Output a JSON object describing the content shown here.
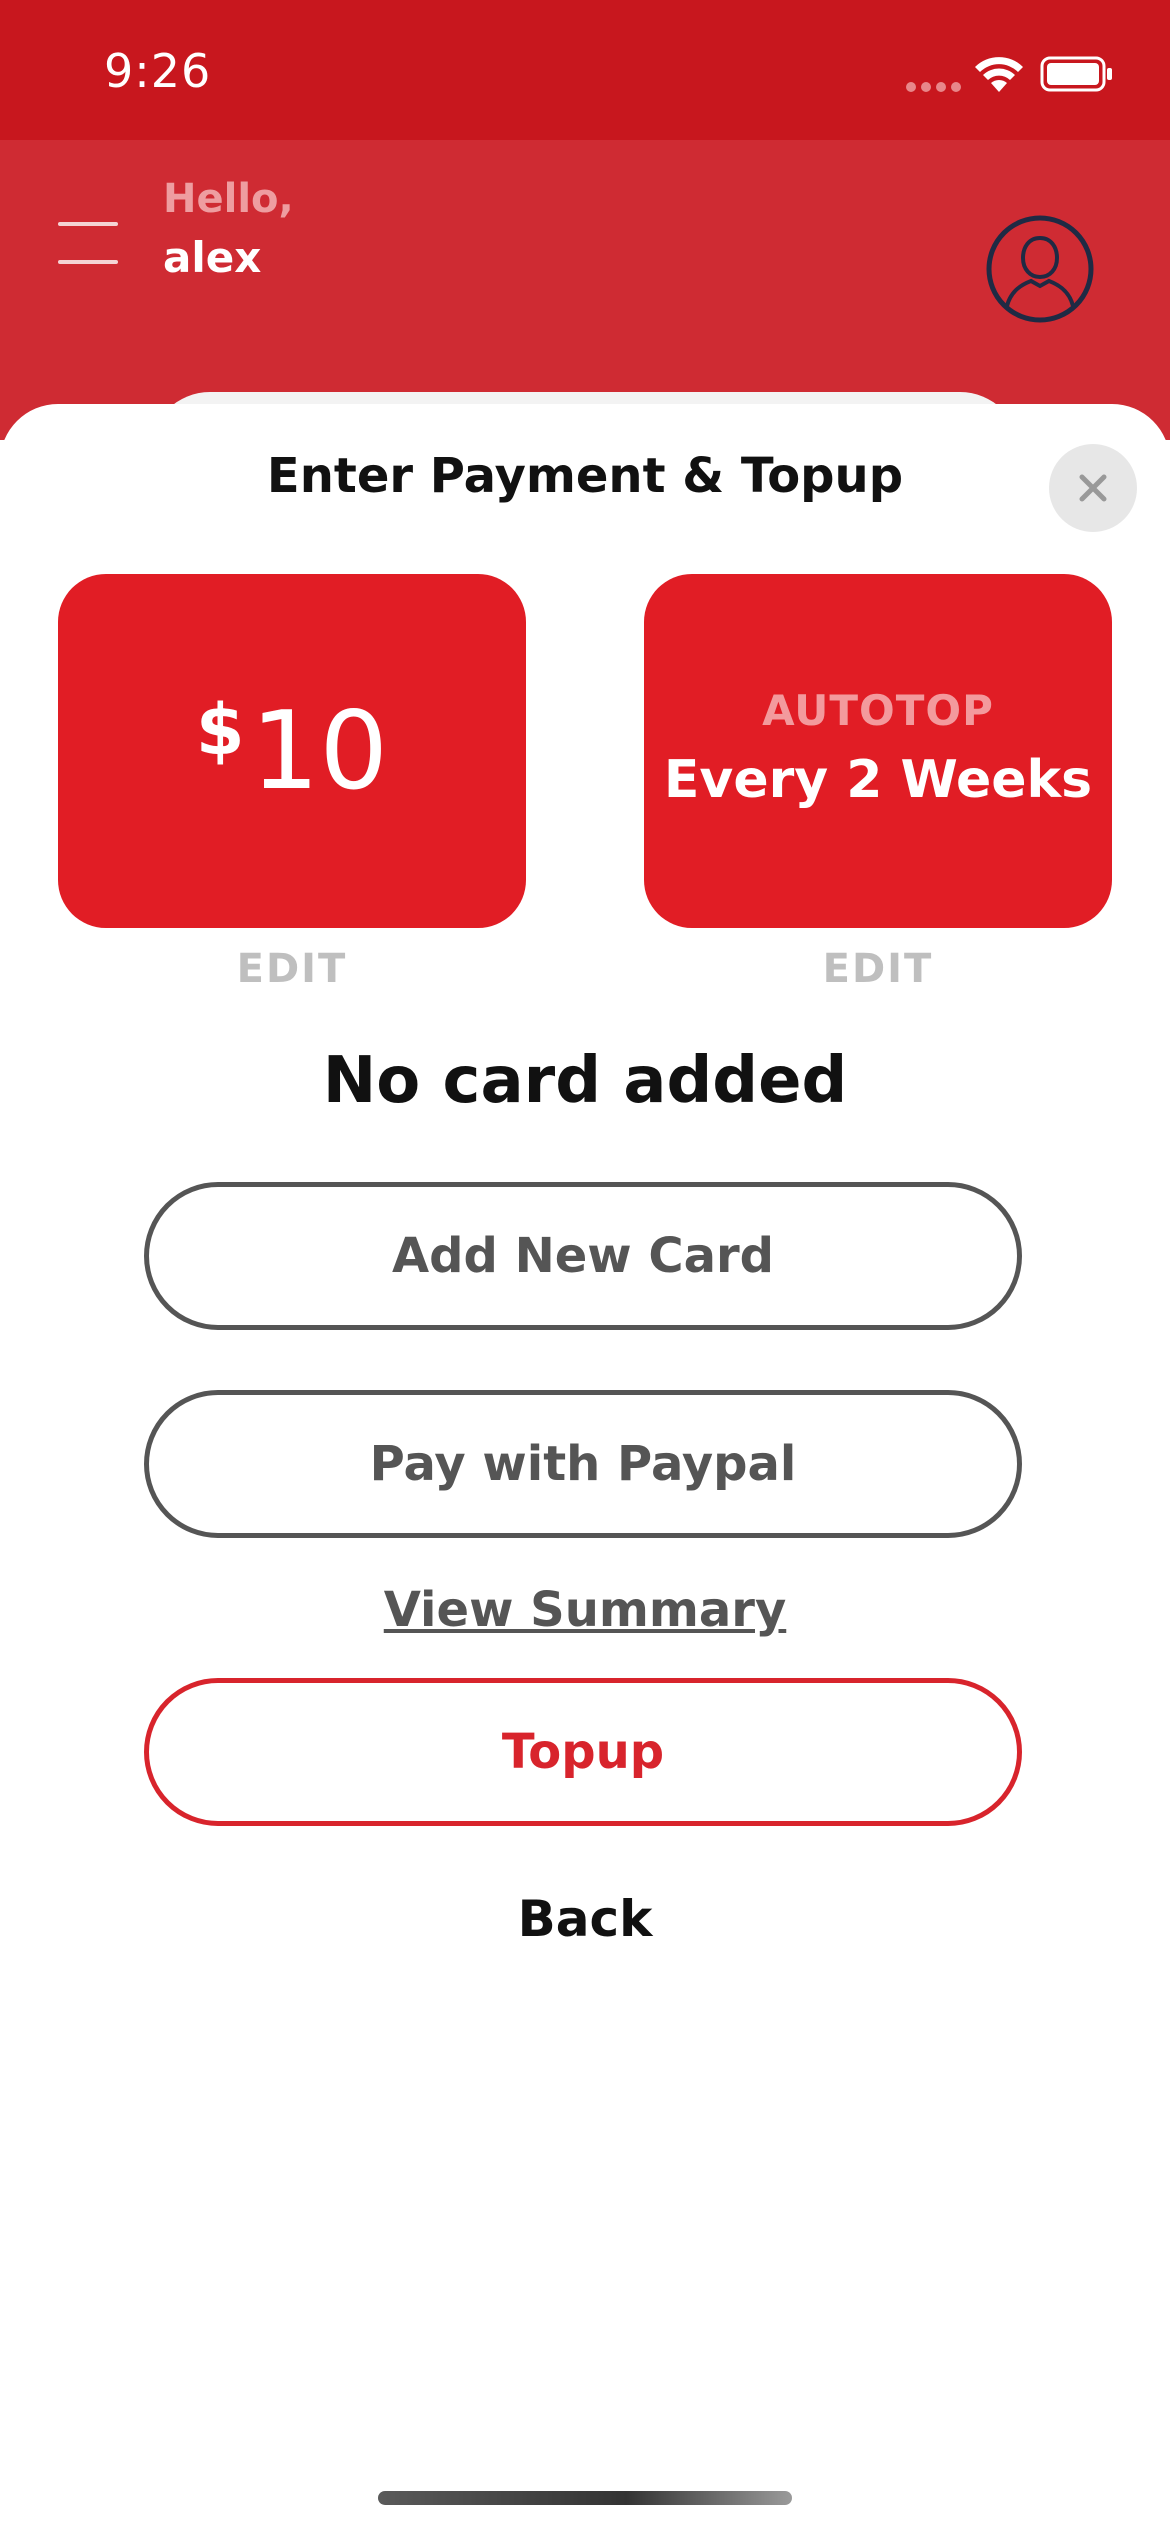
{
  "status_bar": {
    "time": "9:26"
  },
  "header": {
    "hello": "Hello,",
    "name": "alex"
  },
  "sheet": {
    "title": "Enter Payment & Topup",
    "amount_tile": {
      "currency": "$",
      "amount": "10",
      "edit_label": "EDIT"
    },
    "autotop_tile": {
      "label": "AUTOTOP",
      "frequency": "Every 2 Weeks",
      "edit_label": "EDIT"
    },
    "no_card_text": "No card added",
    "add_card_label": "Add New Card",
    "paypal_label": "Pay with Paypal",
    "view_summary_label": "View Summary",
    "topup_label": "Topup",
    "back_label": "Back"
  },
  "colors": {
    "brand_red": "#e11d25",
    "header_red": "#cf2b33",
    "status_red": "#c8171e"
  }
}
